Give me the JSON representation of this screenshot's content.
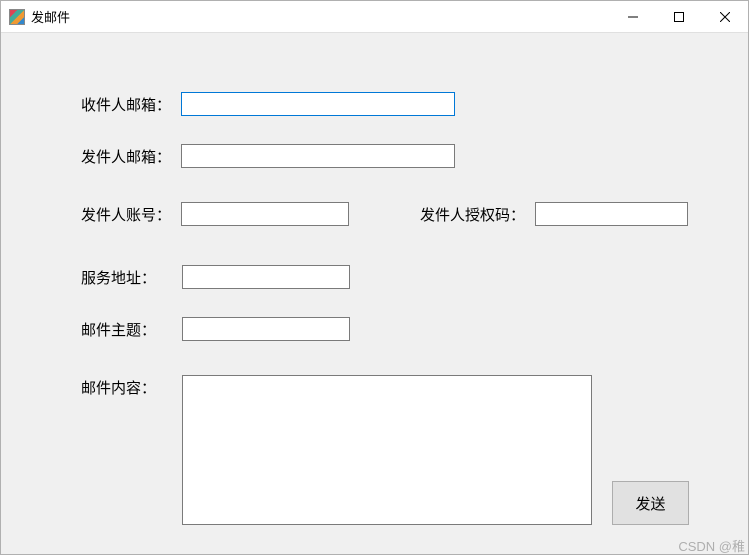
{
  "window": {
    "title": "发邮件"
  },
  "labels": {
    "recipient": "收件人邮箱：",
    "sender": "发件人邮箱：",
    "account": "发件人账号：",
    "authcode": "发件人授权码：",
    "server": "服务地址：",
    "subject": "邮件主题：",
    "body": "邮件内容："
  },
  "fields": {
    "recipient": "",
    "sender": "",
    "account": "",
    "authcode": "",
    "server": "",
    "subject": "",
    "body": ""
  },
  "buttons": {
    "send": "发送"
  },
  "watermark": "CSDN @稚"
}
